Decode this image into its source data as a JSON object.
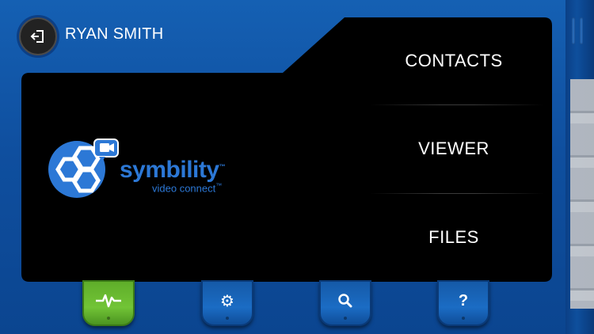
{
  "header": {
    "user_name": "RYAN SMITH",
    "back_icon": "exit-icon"
  },
  "menu": {
    "items": [
      {
        "label": "CONTACTS"
      },
      {
        "label": "VIEWER"
      },
      {
        "label": "FILES"
      }
    ]
  },
  "logo": {
    "brand": "symbility",
    "trademark": "™",
    "subtitle": "video connect",
    "subtitle_tm": "™",
    "color": "#2c78d6"
  },
  "tabbar": {
    "tabs": [
      {
        "icon": "activity-pulse-icon",
        "active": true,
        "color": "#6abb31"
      },
      {
        "icon": "gear-icon",
        "active": false,
        "glyph": "⚙"
      },
      {
        "icon": "search-icon",
        "active": false
      },
      {
        "icon": "help-icon",
        "active": false,
        "glyph": "?"
      }
    ]
  },
  "colors": {
    "frame": "#0f4f9f",
    "screen": "#000000",
    "accent_green": "#6abb31"
  }
}
